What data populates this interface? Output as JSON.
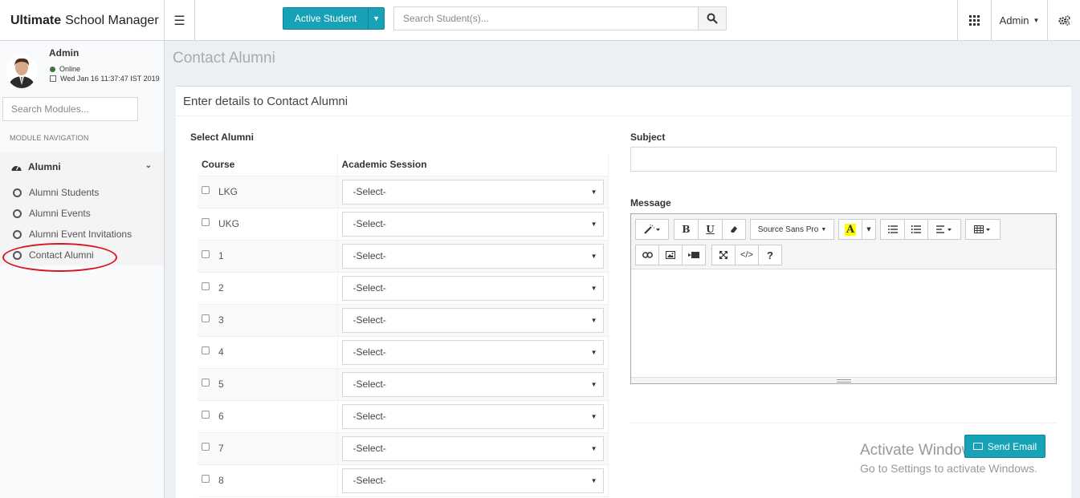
{
  "app": {
    "brand_bold": "Ultimate",
    "brand_rest": "School Manager"
  },
  "header": {
    "active_student_label": "Active Student",
    "search_placeholder": "Search Student(s)...",
    "admin_label": "Admin"
  },
  "user": {
    "name": "Admin",
    "status": "Online",
    "datetime": "Wed Jan 16 11:37:47 IST 2019"
  },
  "sidebar": {
    "search_placeholder": "Search Modules...",
    "module_header": "MODULE NAVIGATION",
    "section_label": "Alumni",
    "items": [
      {
        "label": "Alumni Students"
      },
      {
        "label": "Alumni Events"
      },
      {
        "label": "Alumni Event Invitations"
      },
      {
        "label": "Contact Alumni"
      }
    ]
  },
  "page": {
    "title": "Contact Alumni",
    "box_title": "Enter details to Contact Alumni",
    "select_alumni_label": "Select Alumni",
    "col_course": "Course",
    "col_session": "Academic Session",
    "select_placeholder": "-Select-",
    "courses": [
      "LKG",
      "UKG",
      "1",
      "2",
      "3",
      "4",
      "5",
      "6",
      "7",
      "8"
    ],
    "subject_label": "Subject",
    "message_label": "Message",
    "font_name": "Source Sans Pro",
    "send_label": "Send Email"
  },
  "watermark": {
    "title": "Activate Windows",
    "subtitle": "Go to Settings to activate Windows."
  },
  "colors": {
    "accent": "#17a2b8",
    "highlight": "#d4171f"
  }
}
